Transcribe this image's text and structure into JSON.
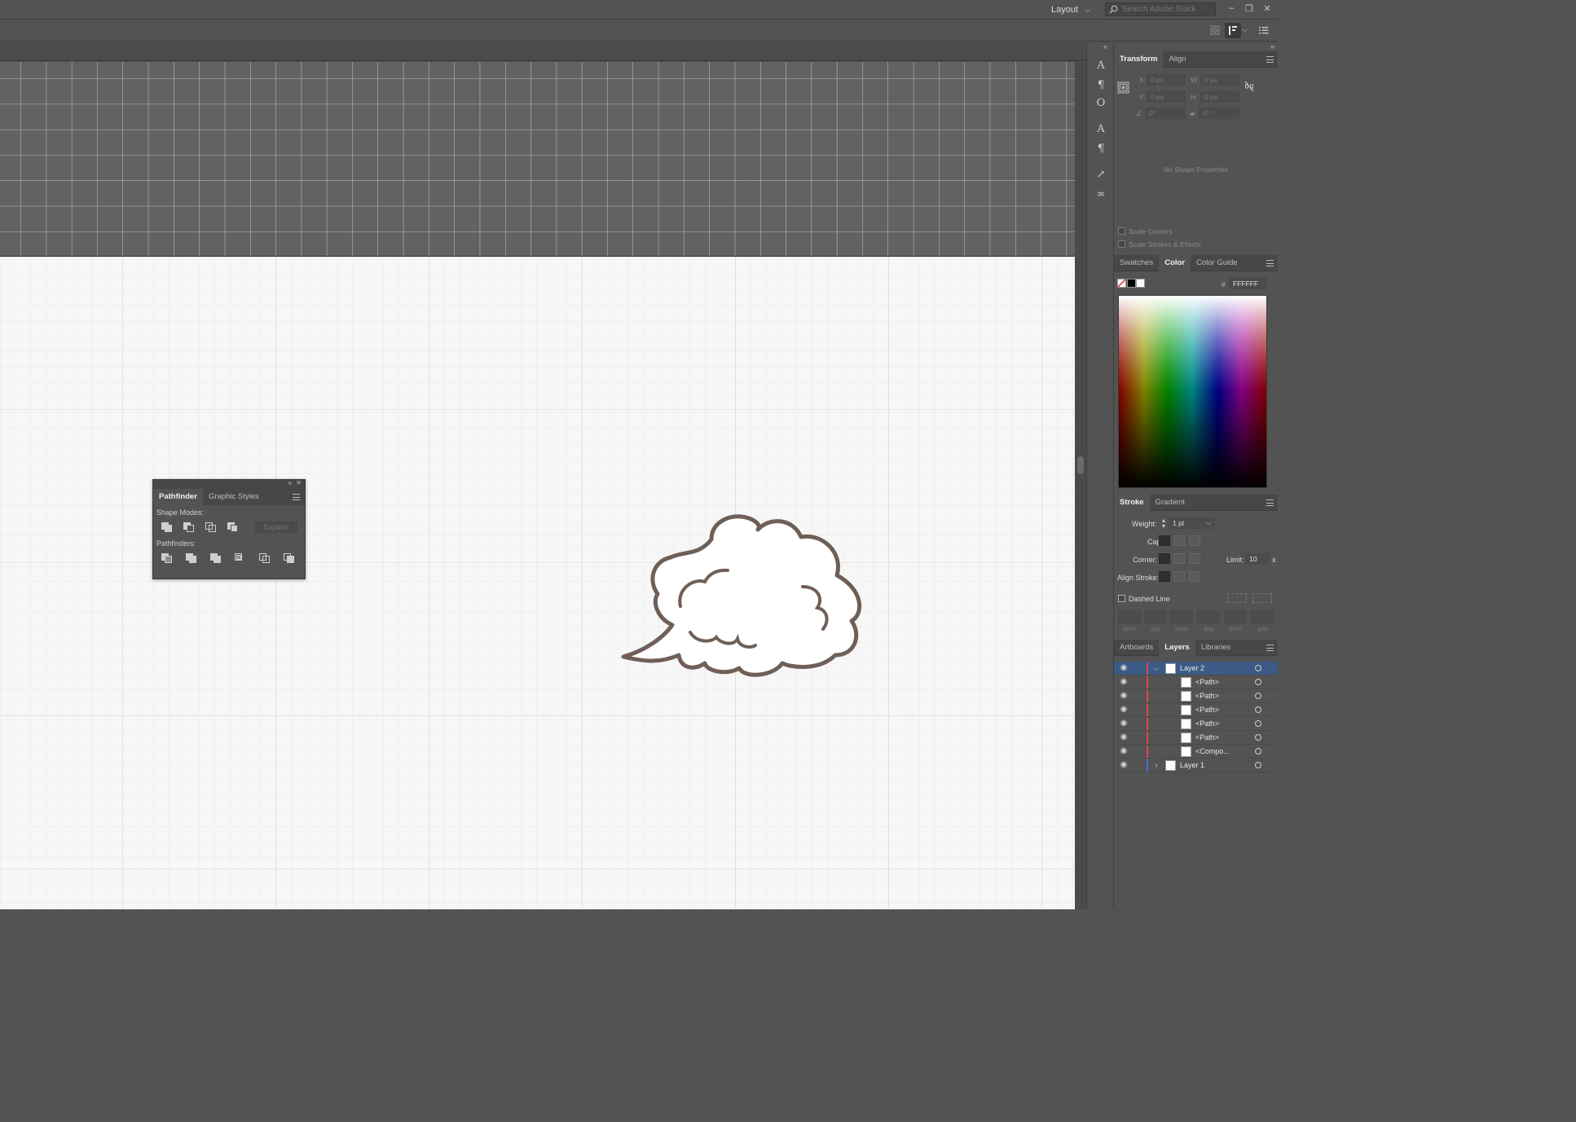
{
  "app": {
    "workspace_label": "Layout",
    "search_placeholder": "Search Adobe Stock"
  },
  "pathfinder_panel": {
    "tabs": [
      "Pathfinder",
      "Graphic Styles"
    ],
    "shape_modes_label": "Shape Modes:",
    "expand_label": "Expand",
    "pathfinders_label": "Pathfinders:"
  },
  "transform_panel": {
    "tabs": [
      "Transform",
      "Align"
    ],
    "x_label": "X:",
    "x_value": "0 px",
    "w_label": "W:",
    "w_value": "0 px",
    "y_label": "Y:",
    "y_value": "0 px",
    "h_label": "H:",
    "h_value": "0 px",
    "rotate_value": "0°",
    "shear_value": "0°",
    "no_props": "No Shape Properties",
    "scale_corners": "Scale Corners",
    "scale_strokes": "Scale Strokes & Effects"
  },
  "color_panel": {
    "tabs": [
      "Swatches",
      "Color",
      "Color Guide"
    ],
    "hash": "#",
    "hex_value": "FFFFFF"
  },
  "stroke_panel": {
    "tabs": [
      "Stroke",
      "Gradient"
    ],
    "weight_label": "Weight:",
    "weight_value": "1 pt",
    "cap_label": "Cap:",
    "corner_label": "Corner:",
    "limit_label": "Limit:",
    "limit_value": "10",
    "limit_unit": "x",
    "align_label": "Align Stroke:",
    "dashed_label": "Dashed Line",
    "dash_labels": [
      "dash",
      "gap",
      "dash",
      "gap",
      "dash",
      "gap"
    ]
  },
  "layers_panel": {
    "tabs": [
      "Artboards",
      "Layers",
      "Libraries"
    ],
    "rows": [
      {
        "name": "Layer 2"
      },
      {
        "name": "<Path>"
      },
      {
        "name": "<Path>"
      },
      {
        "name": "<Path>"
      },
      {
        "name": "<Path>"
      },
      {
        "name": "<Path>"
      },
      {
        "name": "<Compo..."
      },
      {
        "name": "Layer 1"
      }
    ]
  },
  "colors": {
    "ui_bg": "#535353",
    "artboard": "#f7f7f7",
    "layer2_color": "#e0434a",
    "layer1_color": "#4a6fe0",
    "cloud_stroke": "#6f5f57",
    "selection": "#3b5b86"
  }
}
